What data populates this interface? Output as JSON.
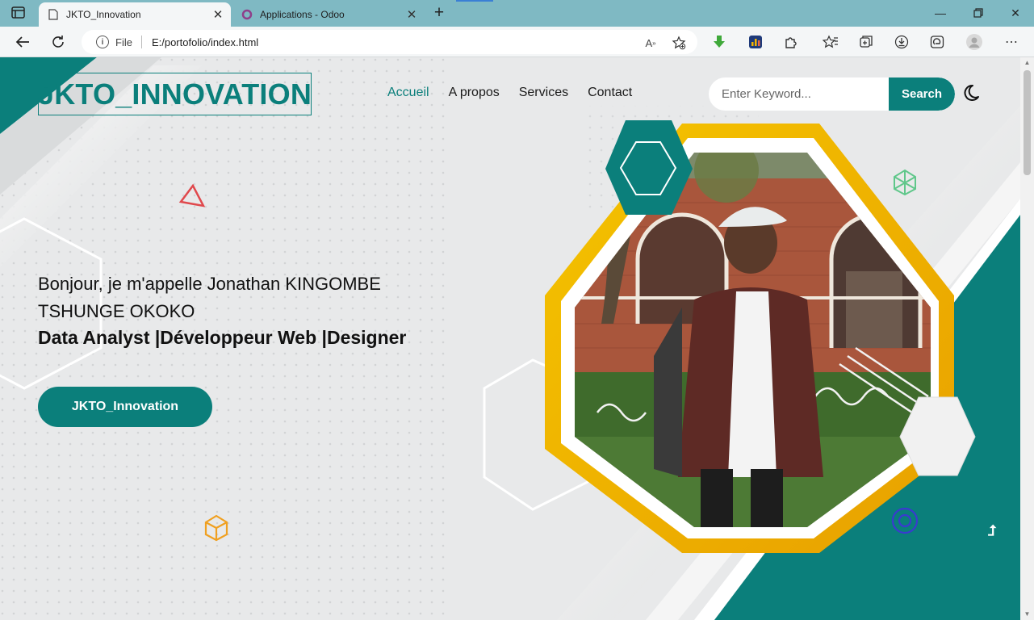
{
  "browser": {
    "tabs": [
      {
        "title": "JKTO_Innovation",
        "active": true,
        "icon": "page-icon"
      },
      {
        "title": "Applications - Odoo",
        "active": false,
        "icon": "odoo-icon"
      }
    ],
    "address": {
      "scheme_label": "File",
      "url": "E:/portofolio/index.html"
    }
  },
  "site": {
    "logo": "JKTO_INNOVATION",
    "nav": [
      "Accueil",
      "A propos",
      "Services",
      "Contact"
    ],
    "active_nav": "Accueil",
    "search": {
      "placeholder": "Enter Keyword...",
      "button": "Search"
    },
    "hero": {
      "greeting": "Bonjour, je m'appelle Jonathan KINGOMBE TSHUNGE OKOKO",
      "roles": "Data Analyst |Développeur Web |Designer",
      "cta": "JKTO_Innovation"
    }
  },
  "colors": {
    "accent": "#0b7f7b",
    "frame": "#f0b400",
    "tabbar": "#7fb9c3"
  }
}
